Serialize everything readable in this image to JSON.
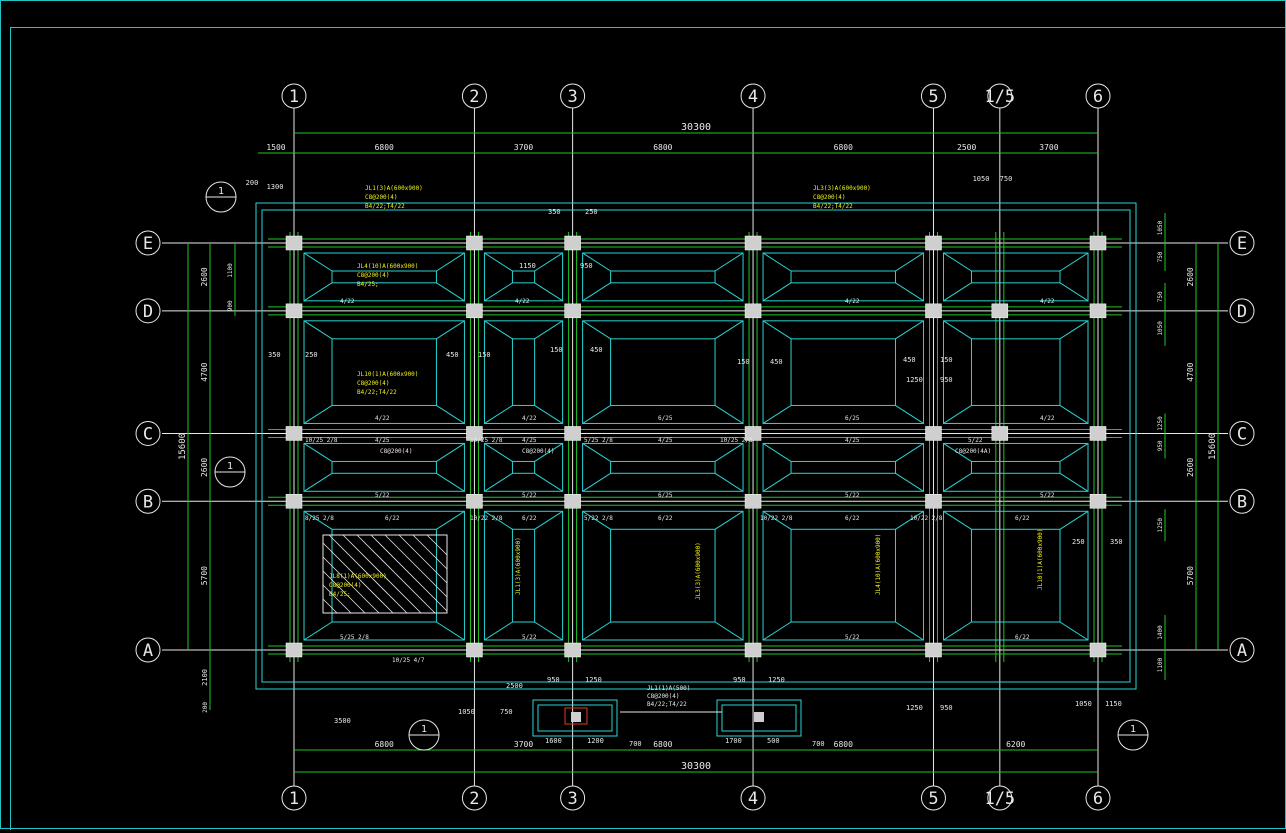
{
  "grid_x": [
    {
      "label": "1",
      "pos": 0
    },
    {
      "label": "2",
      "pos": 6800
    },
    {
      "label": "3",
      "pos": 10500
    },
    {
      "label": "4",
      "pos": 17300
    },
    {
      "label": "5",
      "pos": 24100
    },
    {
      "label": "1/5",
      "pos": 26600
    },
    {
      "label": "6",
      "pos": 30300
    }
  ],
  "grid_y": [
    {
      "label": "E",
      "pos": 15600
    },
    {
      "label": "D",
      "pos": 13000
    },
    {
      "label": "C",
      "pos": 8300
    },
    {
      "label": "B",
      "pos": 5700
    },
    {
      "label": "A",
      "pos": 0
    }
  ],
  "top_total": "30300",
  "bottom_total": "30300",
  "top_spans": [
    "1500",
    "6800",
    "3700",
    "6800",
    "6800",
    "2500",
    "3700"
  ],
  "bottom_spans": [
    "6800",
    "3700",
    "6800",
    "6800",
    "6200"
  ],
  "top_small_dims": [
    "200",
    "1300",
    "1050",
    "750"
  ],
  "left_dims": [
    "2600",
    "4700",
    "2600",
    "5700",
    "2100",
    "200"
  ],
  "left_total": "15600",
  "left_small_dims": [
    "1100",
    "900"
  ],
  "right_dims": [
    "2600",
    "4700",
    "2600",
    "5700"
  ],
  "right_total": "15600",
  "right_small_dims": [
    "1050",
    "750",
    "750",
    "1050",
    "1250",
    "950",
    "1250",
    "1400",
    "1100"
  ],
  "section_markers": [
    "1",
    "1",
    "1",
    "1"
  ],
  "beam_labels": [
    "JL1(3)A(600x900)",
    "C8@200(4)",
    "B4/22;T4/22",
    "JL3(3)A(600x900)",
    "C8@200(4)",
    "B4/22;T4/22",
    "JL4(10)A(600x900)",
    "C8@200(4)",
    "B4/25;",
    "JL10(1)A(600x900)",
    "C8@200(4)",
    "B4/22;T4/22",
    "JL8(1)A(600x900)",
    "C8@200(4)",
    "B4/25;"
  ],
  "reinf_labels": [
    "4/22",
    "5/22",
    "6/25",
    "4/25",
    "6/22",
    "8/25",
    "10/25 2/8",
    "5/25 2/8",
    "8/25 2/8",
    "10/22 2/8",
    "5/22 2/8",
    "C8@200(4)",
    "C8@200(4A)",
    "10/25 4/7"
  ],
  "small_dims": [
    "350",
    "250",
    "150",
    "450",
    "1150",
    "950",
    "1250",
    "1400",
    "2500",
    "3500",
    "1050",
    "1150",
    "750",
    "1600",
    "1200",
    "1700",
    "500",
    "700",
    "2100"
  ],
  "detail_labels": [
    "JL1(1)A(500)",
    "C8@200(4)",
    "B4/22;T4/22",
    "1400",
    "1600",
    "1200",
    "1700"
  ]
}
